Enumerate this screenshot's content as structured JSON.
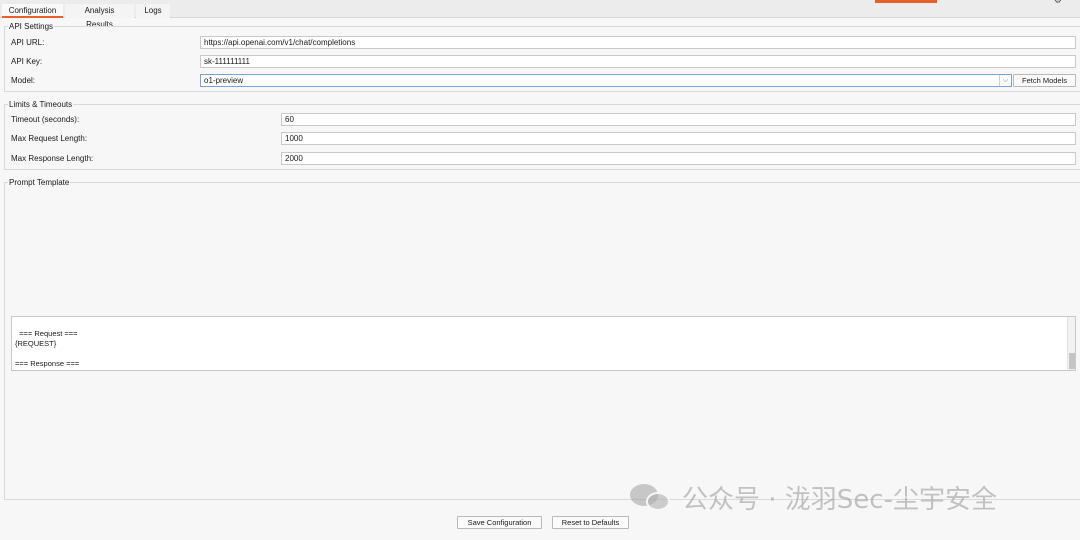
{
  "tabs": [
    {
      "label": "Configuration",
      "active": true
    },
    {
      "label": "Analysis Results",
      "active": false
    },
    {
      "label": "Logs",
      "active": false
    }
  ],
  "api_settings": {
    "title": "API Settings",
    "api_url_label": "API URL:",
    "api_url_value": "https://api.openai.com/v1/chat/completions",
    "api_key_label": "API Key:",
    "api_key_value": "sk-111111111",
    "model_label": "Model:",
    "model_value": "o1-preview",
    "fetch_models_label": "Fetch Models"
  },
  "limits": {
    "title": "Limits & Timeouts",
    "timeout_label": "Timeout (seconds):",
    "timeout_value": "60",
    "max_request_label": "Max Request Length:",
    "max_request_value": "1000",
    "max_response_label": "Max Response Length:",
    "max_response_value": "2000"
  },
  "prompt_template": {
    "title": "Prompt Template",
    "content": "=== Request ===\n{REQUEST}\n\n=== Response ===\n{RESPONSE}"
  },
  "footer": {
    "save_label": "Save Configuration",
    "reset_label": "Reset to Defaults"
  },
  "watermark": {
    "text": "公众号 · 泷羽Sec-尘宇安全",
    "icon": "wechat-icon"
  },
  "colors": {
    "accent": "#e8602c",
    "focus_border": "#7aa4d6"
  }
}
